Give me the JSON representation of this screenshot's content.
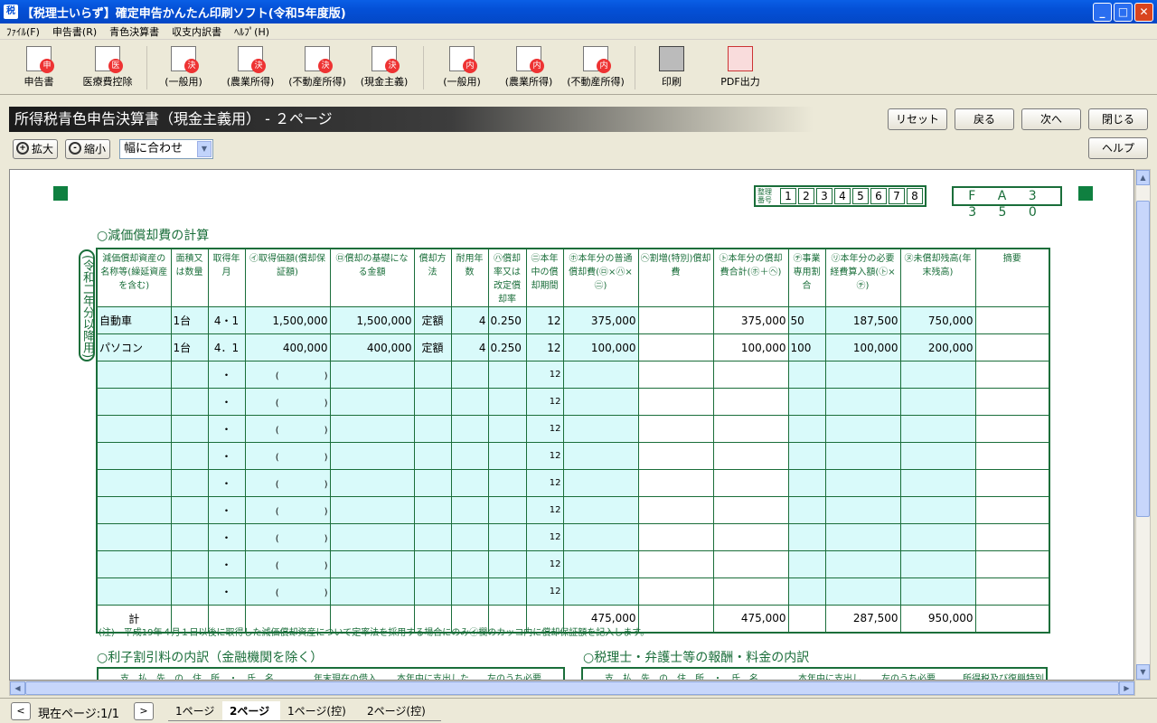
{
  "window": {
    "title": "【税理士いらず】確定申告かんたん印刷ソフト(令和5年度版)",
    "min": "_",
    "max": "□",
    "close": "✕"
  },
  "menu": [
    "ﾌｧｲﾙ(F)",
    "申告書(R)",
    "青色決算書",
    "収支内訳書",
    "ﾍﾙﾌﾟ(H)"
  ],
  "toolbar": [
    {
      "label": "申告書",
      "badge": "申"
    },
    {
      "label": "医療費控除",
      "badge": "医"
    },
    {
      "label": "(一般用)",
      "badge": "決"
    },
    {
      "label": "(農業所得)",
      "badge": "決"
    },
    {
      "label": "(不動産所得)",
      "badge": "決"
    },
    {
      "label": "(現金主義)",
      "badge": "決"
    },
    {
      "label": "(一般用)",
      "badge": "内"
    },
    {
      "label": "(農業所得)",
      "badge": "内"
    },
    {
      "label": "(不動産所得)",
      "badge": "内"
    },
    {
      "label": "印刷",
      "badge": ""
    },
    {
      "label": "PDF出力",
      "badge": ""
    }
  ],
  "header": {
    "title": "所得税青色申告決算書（現金主義用） - ２ページ",
    "buttons": [
      "リセット",
      "戻る",
      "次へ",
      "閉じる",
      "ヘルプ"
    ],
    "zoom_in": "拡大",
    "zoom_out": "縮小",
    "zoom_select": "幅に合わせ"
  },
  "form": {
    "seiri_label": "整理番号",
    "seiri_digits": [
      "1",
      "2",
      "3",
      "4",
      "5",
      "6",
      "7",
      "8"
    ],
    "fcode": "F A 3 3 5 0",
    "section1": "○減価償却費の計算",
    "side_label": "(令和二年分以降用)",
    "cols": [
      "減価償却資産の名称等(繰延資産を含む)",
      "面積又は数量",
      "取得年月",
      "㋑取得価額(償却保証額)",
      "㋺償却の基礎になる金額",
      "償却方法",
      "耐用年数",
      "㋩償却率又は改定償却率",
      "㊁本年中の償却期間",
      "㋭本年分の普通償却費(㋺×㋩×㊁)",
      "㋬割増(特別)償却費",
      "㋣本年分の償却費合計(㋭＋㋬)",
      "㋠事業専用割合",
      "㋷本年分の必要経費算入額(㋣×㋠)",
      "㋦未償却残高(年末残高)",
      "摘要"
    ],
    "rows": [
      {
        "name": "自動車",
        "qty": "1台",
        "date": "4・1",
        "cost": "1,500,000",
        "base": "1,500,000",
        "method": "定額",
        "life": "4",
        "rate": "0.250",
        "period": "12",
        "normal": "375,000",
        "special": "",
        "total": "375,000",
        "ratio": "50",
        "expense": "187,500",
        "remain": "750,000",
        "note": ""
      },
      {
        "name": "パソコン",
        "qty": "1台",
        "date": "4．1",
        "cost": "400,000",
        "base": "400,000",
        "method": "定額",
        "life": "4",
        "rate": "0.250",
        "period": "12",
        "normal": "100,000",
        "special": "",
        "total": "100,000",
        "ratio": "100",
        "expense": "100,000",
        "remain": "200,000",
        "note": ""
      }
    ],
    "empty_rows": 9,
    "dot": "・",
    "paren": "(　　　　　)",
    "twelve": "12",
    "total_label": "計",
    "total": {
      "normal": "475,000",
      "total": "475,000",
      "expense": "287,500",
      "remain": "950,000"
    },
    "note": "(注)　平成19年４月１日以後に取得した減価償却資産について定率法を採用する場合にのみ㋑欄のカッコ内に償却保証額を記入します。",
    "section2": "○利子割引料の内訳（金融機関を除く）",
    "section3": "○税理士・弁護士等の報酬・料金の内訳",
    "sub2": [
      "支　払　先　の　住　所　・　氏　名",
      "年末現在の借入",
      "本年中に支出した",
      "左のうち必要"
    ],
    "sub3": [
      "支　払　先　の　住　所　・　氏　名",
      "本年中に支出し",
      "左のうち必要",
      "所得税及び復興特別"
    ]
  },
  "status": {
    "page_info": "現在ページ:1/1",
    "tabs": [
      "1ページ",
      "2ページ",
      "1ページ(控)",
      "2ページ(控)"
    ]
  }
}
